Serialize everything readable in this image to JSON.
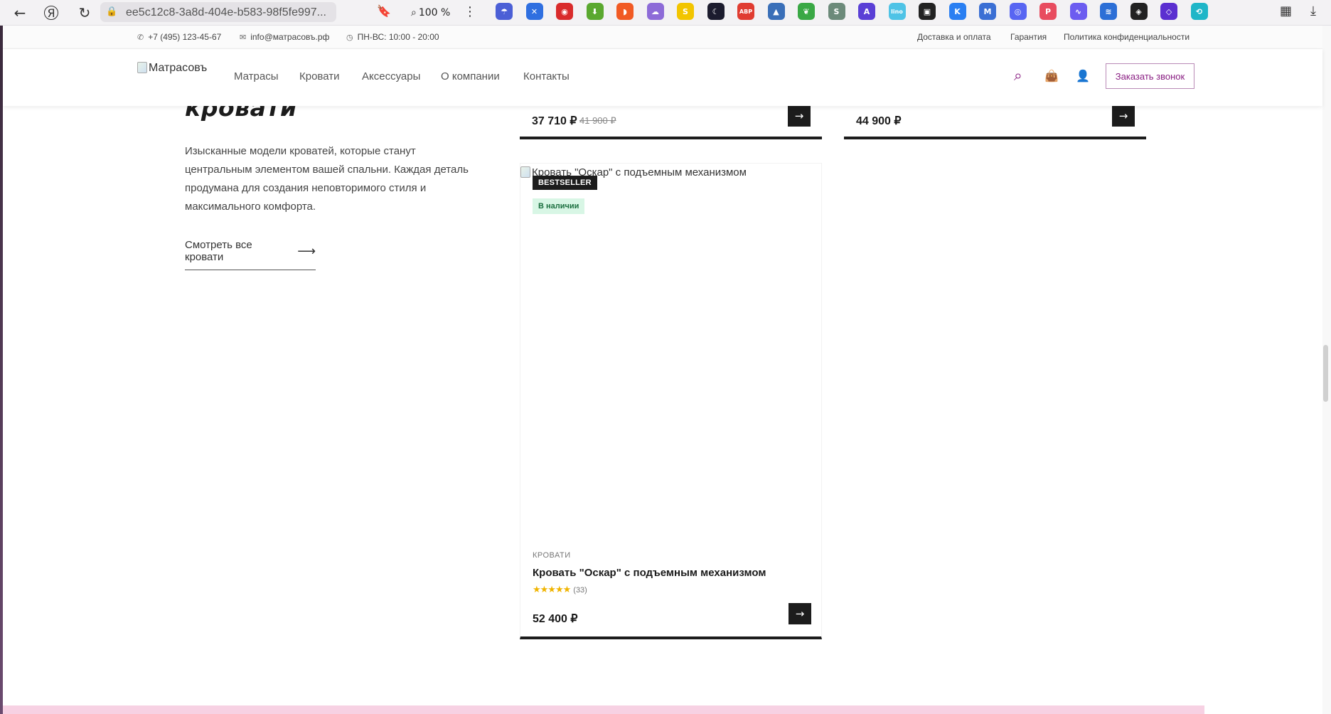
{
  "browser": {
    "nav": {
      "back_icon": "←",
      "yandex_icon": "Я",
      "reload_icon": "↻"
    },
    "address": {
      "url": "ee5c12c8-3a8d-404e-b583-98f5fe997...",
      "lock_icon": "🔒"
    },
    "bookmark_icon": "🔖",
    "zoom": {
      "icon": "⌕",
      "label": "100 %"
    },
    "menu_icon": "⋮",
    "extensions": [
      {
        "name": "vpn-extension",
        "glyph": "☂",
        "color": "#4b5fd6"
      },
      {
        "name": "x-extension",
        "glyph": "✕",
        "color": "#2f6fe0"
      },
      {
        "name": "red-extension",
        "glyph": "◉",
        "color": "#d92b2b"
      },
      {
        "name": "download-extension",
        "glyph": "⬇",
        "color": "#5aa82f"
      },
      {
        "name": "orange-extension",
        "glyph": "◗",
        "color": "#f15a24"
      },
      {
        "name": "purple-cloud-extension",
        "glyph": "☁",
        "color": "#8d6bd8"
      },
      {
        "name": "yellow-s-extension",
        "glyph": "S",
        "color": "#f2c500"
      },
      {
        "name": "dark-moon-extension",
        "glyph": "☾",
        "color": "#1c1c2e"
      },
      {
        "name": "abp-extension",
        "glyph": "ABP",
        "color": "#e03c31"
      },
      {
        "name": "chart-extension",
        "glyph": "▲",
        "color": "#3a6fb8"
      },
      {
        "name": "leaf-extension",
        "glyph": "❦",
        "color": "#3aa845"
      },
      {
        "name": "s-box-extension",
        "glyph": "S",
        "color": "#6c8a7a"
      },
      {
        "name": "a-extension",
        "glyph": "A",
        "color": "#5a3fd6"
      },
      {
        "name": "lino-extension",
        "glyph": "lino",
        "color": "#4fc3e6"
      },
      {
        "name": "tab-extension",
        "glyph": "▣",
        "color": "#222222"
      },
      {
        "name": "k-extension",
        "glyph": "K",
        "color": "#2a7ff2"
      },
      {
        "name": "mls-extension",
        "glyph": "M",
        "color": "#3b6fd4"
      },
      {
        "name": "discord-extension",
        "glyph": "◎",
        "color": "#5865f2"
      },
      {
        "name": "p-extension",
        "glyph": "P",
        "color": "#e84c5f"
      },
      {
        "name": "wave-extension",
        "glyph": "∿",
        "color": "#6c5cf0"
      },
      {
        "name": "layers-extension",
        "glyph": "≋",
        "color": "#2c6fd6"
      },
      {
        "name": "gold-extension",
        "glyph": "◈",
        "color": "#222222"
      },
      {
        "name": "diamond-extension",
        "glyph": "◇",
        "color": "#5b2fd0"
      },
      {
        "name": "cyan-extension",
        "glyph": "⟲",
        "color": "#1fb6c8"
      }
    ],
    "right": {
      "collections_icon": "▦",
      "download_icon": "⤓"
    }
  },
  "topbar": {
    "phone_icon": "✆",
    "phone": "+7 (495) 123-45-67",
    "email_icon": "✉",
    "email": "info@матрасовъ.рф",
    "hours_icon": "◷",
    "hours": "ПН-ВС: 10:00 - 20:00",
    "links": [
      "Доставка и оплата",
      "Гарантия",
      "Политика конфиденциальности"
    ]
  },
  "header": {
    "logo_alt": "Матрасовъ",
    "nav": [
      "Матрасы",
      "Кровати",
      "Аксессуары",
      "О компании",
      "Контакты"
    ],
    "search_icon": "⌕",
    "cart_icon": "👜",
    "user_icon": "👤",
    "callback_label": "Заказать звонок"
  },
  "intro": {
    "heading_partial": "кровати",
    "description": "Изысканные модели кроватей, которые станут центральным элементом вашей спальни. Каждая деталь продумана для создания неповторимого стиля и максимального комфорта.",
    "see_all_label": "Смотреть все кровати",
    "see_all_arrow": "⟶"
  },
  "products": [
    {
      "price": "37 710 ₽",
      "old_price": "41 900 ₽",
      "arrow": "→"
    },
    {
      "price": "44 900 ₽",
      "arrow": "→"
    },
    {
      "image_alt": "Кровать \"Оскар\" с подъемным механизмом",
      "badge": "BESTSELLER",
      "stock": "В наличии",
      "category": "КРОВАТИ",
      "title": "Кровать \"Оскар\" с подъемным механизмом",
      "stars": "★★★★★",
      "rating_count": "(33)",
      "rating": 5,
      "price": "52 400 ₽",
      "arrow": "→"
    }
  ]
}
